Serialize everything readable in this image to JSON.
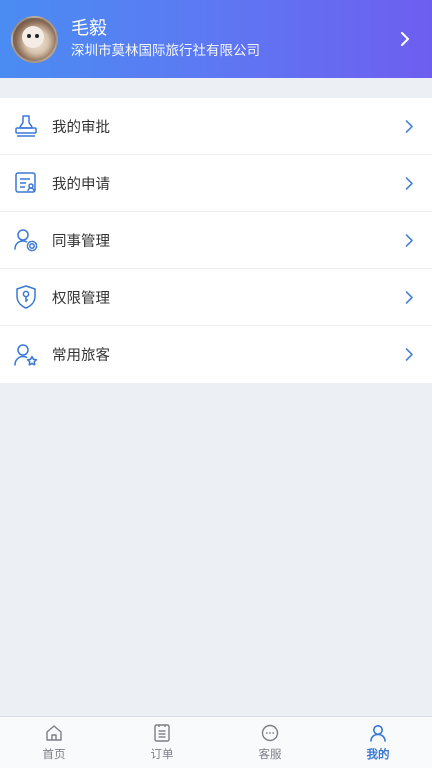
{
  "header": {
    "user_name": "毛毅",
    "company": "深圳市莫林国际旅行社有限公司",
    "avatar_icon": "cat-avatar",
    "chevron_icon": "chevron-right-icon"
  },
  "menu": {
    "items": [
      {
        "label": "我的审批",
        "icon": "stamp-icon"
      },
      {
        "label": "我的申请",
        "icon": "form-icon"
      },
      {
        "label": "同事管理",
        "icon": "user-gear-icon"
      },
      {
        "label": "权限管理",
        "icon": "shield-key-icon"
      },
      {
        "label": "常用旅客",
        "icon": "user-star-icon"
      }
    ]
  },
  "tabbar": {
    "tabs": [
      {
        "label": "首页",
        "icon": "home-icon",
        "active": false
      },
      {
        "label": "订单",
        "icon": "order-icon",
        "active": false
      },
      {
        "label": "客服",
        "icon": "chat-icon",
        "active": false
      },
      {
        "label": "我的",
        "icon": "user-icon",
        "active": true
      }
    ]
  },
  "colors": {
    "accent": "#3a78d6",
    "header_gradient_start": "#4a8cf2",
    "header_gradient_end": "#6e5ef0",
    "background": "#eceff3"
  }
}
